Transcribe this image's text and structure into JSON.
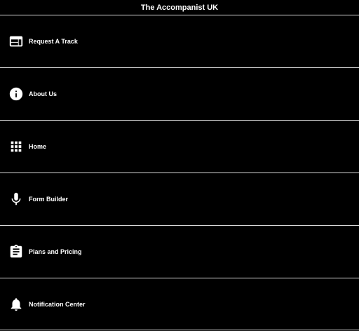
{
  "header": {
    "title": "The Accompanist UK"
  },
  "colors": {
    "background": "#000000",
    "text": "#ffffff",
    "divider": "#d9d9d9"
  },
  "menu": {
    "items": [
      {
        "label": "Request A Track",
        "icon": "web-icon"
      },
      {
        "label": "About Us",
        "icon": "info-icon"
      },
      {
        "label": "Home",
        "icon": "apps-grid-icon"
      },
      {
        "label": "Form Builder",
        "icon": "microphone-icon"
      },
      {
        "label": "Plans and Pricing",
        "icon": "clipboard-icon"
      },
      {
        "label": "Notification Center",
        "icon": "bell-icon"
      }
    ]
  }
}
